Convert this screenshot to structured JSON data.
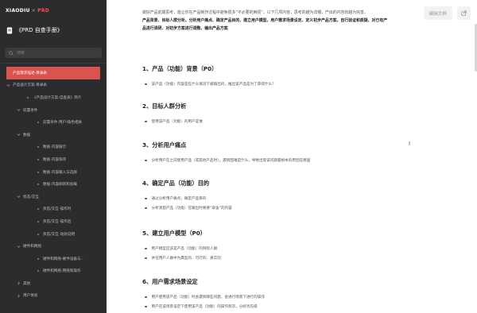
{
  "brand": {
    "logo": "XIAODIU",
    "separator": "×",
    "product": "PRD"
  },
  "doc_title": "《PRD 自查手册》",
  "search": {
    "placeholder": "搜索"
  },
  "sidebar_items": [
    {
      "label": "产品需求描述-目录表",
      "level": 0,
      "active": true,
      "kind": "plain"
    },
    {
      "label": "产品设计方案-目录表",
      "level": 0,
      "active": false,
      "kind": "chev-open"
    },
    {
      "label": "《产品设计方案-自查表》简介",
      "level": 1,
      "active": false,
      "kind": "dot"
    },
    {
      "label": "前置条件",
      "level": 1,
      "active": false,
      "kind": "chev-open"
    },
    {
      "label": "前置条件-用户/角色相关",
      "level": 2,
      "active": false,
      "kind": "dot"
    },
    {
      "label": "数据",
      "level": 1,
      "active": false,
      "kind": "chev-open"
    },
    {
      "label": "数据-内容展示",
      "level": 2,
      "active": false,
      "kind": "dot"
    },
    {
      "label": "数据-内容排序",
      "level": 2,
      "active": false,
      "kind": "dot"
    },
    {
      "label": "数据-内容输入与选择",
      "level": 2,
      "active": false,
      "kind": "dot"
    },
    {
      "label": "数据-内容刷新和加载",
      "level": 2,
      "active": false,
      "kind": "dot"
    },
    {
      "label": "状态/交互",
      "level": 1,
      "active": false,
      "kind": "chev-open"
    },
    {
      "label": "状态/交互-操作时",
      "level": 2,
      "active": false,
      "kind": "dot"
    },
    {
      "label": "状态/交互-操作后",
      "level": 2,
      "active": false,
      "kind": "dot"
    },
    {
      "label": "状态/交互-动效说明",
      "level": 2,
      "active": false,
      "kind": "dot"
    },
    {
      "label": "硬件和网络",
      "level": 1,
      "active": false,
      "kind": "chev-open"
    },
    {
      "label": "硬件和网络-硬件设备与...",
      "level": 2,
      "active": false,
      "kind": "dot"
    },
    {
      "label": "硬件和网络-网络和操作",
      "level": 2,
      "active": false,
      "kind": "dot"
    },
    {
      "label": "其他",
      "level": 1,
      "active": false,
      "kind": "chev"
    },
    {
      "label": "用户体验",
      "level": 1,
      "active": false,
      "kind": "chev"
    }
  ],
  "toolbar": {
    "edit_label": "编辑文档"
  },
  "intro": {
    "line1": "做好产品前期思考，能让你在产品制作过程中避免很多“不必要的麻烦”，以下几项内容，思考的越为详细，产出的内容就越为完善。",
    "line2": "产品背景、目标人群分析、分析用户痛点、确定产品目的、建立用户模型、用户需求场景设定、定义初步产品方案、自行验证和质疑、对已有产",
    "line3": "品进行调研、对初步方案进行调整、输出产品方案"
  },
  "sections": [
    {
      "title": "1、产品（功能）背景（P0）",
      "bullets": [
        "该产品（功能）内容是在什么情况下被输出的，推出该产品是为了获得什么？"
      ]
    },
    {
      "title": "2、目标人群分析",
      "bullets": [
        "使用该产品（功能）的用户是谁"
      ]
    },
    {
      "title": "3、分析用户痛点",
      "bullets": [
        "分析用户在之前使用产品（或其他产品时），遇到困难是什么，导致出现该问题最根本的原因在哪里"
      ]
    },
    {
      "title": "4、确定产品（功能）目的",
      "bullets": [
        "通过分析用户痛点，确定产品目的",
        "分析清楚产品（功能）在输出时要要“取舍”的内容"
      ]
    },
    {
      "title": "5、建立用户模型（P0）",
      "bullets": [
        "用户模型应该是产品（功能）的目标人群",
        "并在用户人群中为典型的、可行的、真实的"
      ]
    },
    {
      "title": "6、用户需求场景设定",
      "bullets": [
        "用户使用该产品（功能）时会遇到哪些问题，会进行场景下进行的操作",
        "用户在该场景设定下使用该产品（功能）的操作频次，分好优先级"
      ]
    }
  ]
}
